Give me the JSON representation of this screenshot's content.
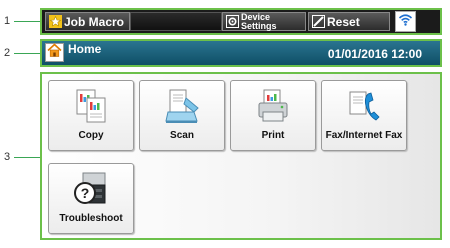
{
  "callouts": [
    "1",
    "2",
    "3"
  ],
  "toolbar": {
    "job_macro_label": "Job Macro",
    "device_settings_line1": "Device",
    "device_settings_line2": "Settings",
    "reset_label": "Reset",
    "wifi_icon": "wifi-icon"
  },
  "home_bar": {
    "title": "Home",
    "datetime": "01/01/2016 12:00"
  },
  "apps": [
    {
      "label": "Copy",
      "icon": "copy-icon"
    },
    {
      "label": "Scan",
      "icon": "scan-icon"
    },
    {
      "label": "Print",
      "icon": "print-icon"
    },
    {
      "label": "Fax/Internet Fax",
      "icon": "fax-icon"
    },
    {
      "label": "Troubleshoot",
      "icon": "troubleshoot-icon"
    }
  ],
  "colors": {
    "frame_green": "#6cc04a",
    "home_bar_teal": "#1b6580",
    "toolbar_black": "#1b1b1b"
  }
}
